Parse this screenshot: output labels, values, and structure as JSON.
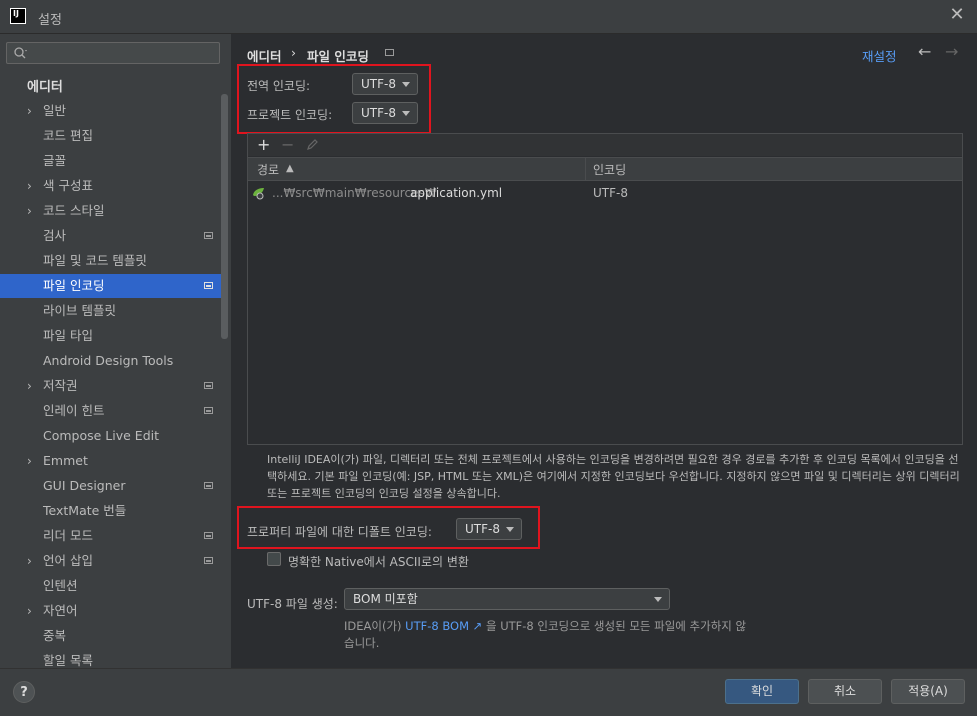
{
  "window": {
    "title": "설정",
    "icon_text": "IJ"
  },
  "sidebar": {
    "search_placeholder": "",
    "section_header": "에디터",
    "items": [
      {
        "label": "일반",
        "expandable": true,
        "project": false
      },
      {
        "label": "코드 편집",
        "expandable": false,
        "project": false
      },
      {
        "label": "글꼴",
        "expandable": false,
        "project": false
      },
      {
        "label": "색 구성표",
        "expandable": true,
        "project": false
      },
      {
        "label": "코드 스타일",
        "expandable": true,
        "project": false
      },
      {
        "label": "검사",
        "expandable": false,
        "project": true
      },
      {
        "label": "파일 및 코드 템플릿",
        "expandable": false,
        "project": false
      },
      {
        "label": "파일 인코딩",
        "expandable": false,
        "project": true,
        "selected": true
      },
      {
        "label": "라이브 템플릿",
        "expandable": false,
        "project": false
      },
      {
        "label": "파일 타입",
        "expandable": false,
        "project": false
      },
      {
        "label": "Android Design Tools",
        "expandable": false,
        "project": false
      },
      {
        "label": "저작권",
        "expandable": true,
        "project": true
      },
      {
        "label": "인레이 힌트",
        "expandable": false,
        "project": true
      },
      {
        "label": "Compose Live Edit",
        "expandable": false,
        "project": false
      },
      {
        "label": "Emmet",
        "expandable": true,
        "project": false
      },
      {
        "label": "GUI Designer",
        "expandable": false,
        "project": true
      },
      {
        "label": "TextMate 번들",
        "expandable": false,
        "project": false
      },
      {
        "label": "리더 모드",
        "expandable": false,
        "project": true
      },
      {
        "label": "언어 삽입",
        "expandable": true,
        "project": true
      },
      {
        "label": "인텐션",
        "expandable": false,
        "project": false
      },
      {
        "label": "자연어",
        "expandable": true,
        "project": false
      },
      {
        "label": "중복",
        "expandable": false,
        "project": false
      },
      {
        "label": "할일 목록",
        "expandable": false,
        "project": false
      }
    ]
  },
  "header": {
    "breadcrumb": [
      "에디터",
      "파일 인코딩"
    ],
    "reset_label": "재설정"
  },
  "encoding": {
    "global_label": "전역 인코딩:",
    "global_value": "UTF-8",
    "project_label": "프로젝트 인코딩:",
    "project_value": "UTF-8"
  },
  "table": {
    "columns": [
      "경로",
      "인코딩"
    ],
    "sort_indicator": "▲",
    "rows": [
      {
        "path_prefix": "...₩src₩main₩resources₩",
        "path_file": "application.yml",
        "encoding": "UTF-8"
      }
    ]
  },
  "description": "IntelliJ IDEA이(가) 파일, 디렉터리 또는 전체 프로젝트에서 사용하는 인코딩을 변경하려면 필요한 경우 경로를 추가한 후 인코딩 목록에서 인코딩을 선택하세요. 기본 파일 인코딩(예: JSP, HTML 또는 XML)은 여기에서 지정한 인코딩보다 우선합니다. 지정하지 않으면 파일 및 디렉터리는 상위 디렉터리 또는 프로젝트 인코딩의 인코딩 설정을 상속합니다.",
  "properties": {
    "label": "프로퍼티 파일에 대한 디폴트 인코딩:",
    "value": "UTF-8",
    "native_to_ascii_label": "명확한 Native에서 ASCII로의 변환",
    "native_to_ascii_checked": false
  },
  "bom": {
    "label": "UTF-8 파일 생성:",
    "value": "BOM 미포함",
    "hint_prefix": "IDEA이(가) ",
    "hint_link": "UTF-8 BOM ↗",
    "hint_suffix": " 을 UTF-8 인코딩으로 생성된 모든 파일에 추가하지 않습니다."
  },
  "footer": {
    "help": "?",
    "ok": "확인",
    "cancel": "취소",
    "apply": "적용(A)"
  },
  "colors": {
    "accent": "#2f65ca",
    "highlight_box": "#e0141e",
    "link": "#589df6"
  }
}
